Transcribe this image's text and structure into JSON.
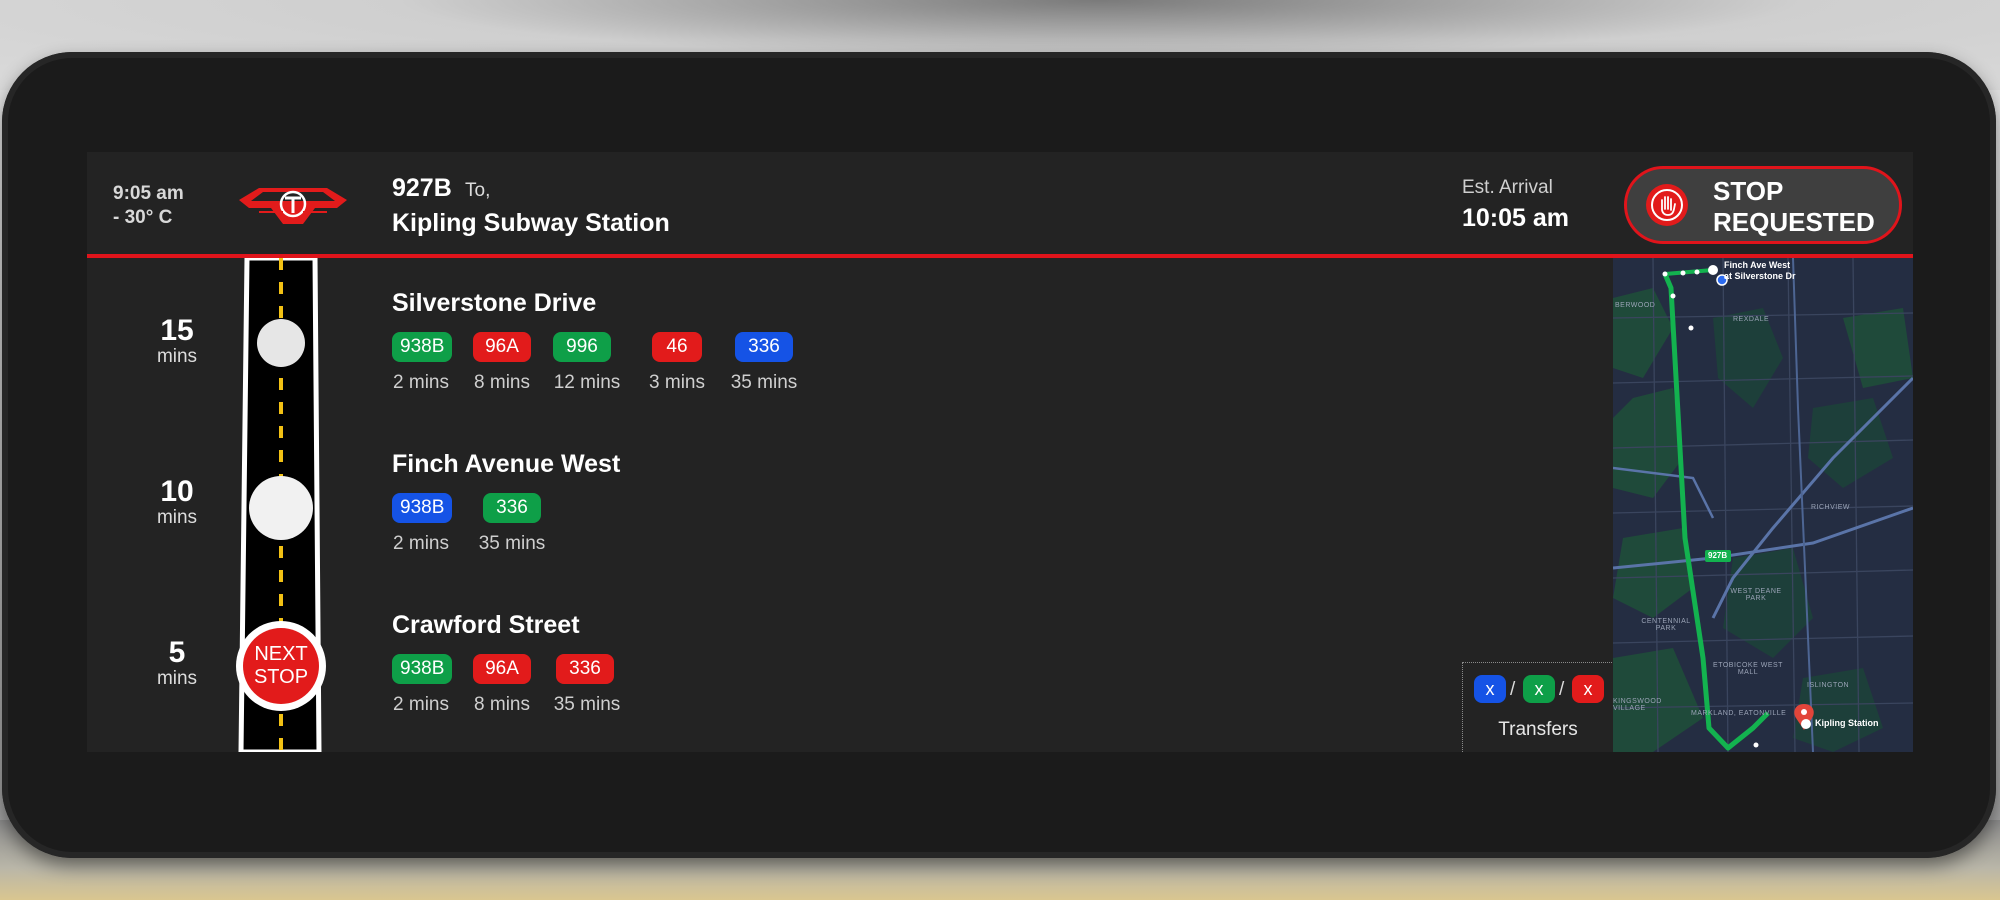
{
  "header": {
    "time": "9:05 am",
    "temperature": "- 30° C",
    "route_number": "927B",
    "route_to": "To,",
    "destination": "Kipling Subway Station",
    "eta_label": "Est. Arrival",
    "eta_time": "10:05 am",
    "stop_button_line1": "STOP",
    "stop_button_line2": "REQUESTED"
  },
  "colors": {
    "green": "#0e9f48",
    "red": "#e21b1b",
    "blue": "#1553e6",
    "accent": "#e0141b"
  },
  "timeline": {
    "next_stop_line1": "NEXT",
    "next_stop_line2": "STOP"
  },
  "stops": [
    {
      "minutes": "15",
      "unit": "mins",
      "name": "Silverstone Drive",
      "routes": [
        {
          "route": "938B",
          "color": "green",
          "time": "2 mins"
        },
        {
          "route": "96A",
          "color": "red",
          "time": "8 mins"
        },
        {
          "route": "996",
          "color": "green",
          "time": "12 mins"
        },
        {
          "route": "46",
          "color": "red",
          "time": "3 mins"
        },
        {
          "route": "336",
          "color": "blue",
          "time": "35 mins"
        }
      ]
    },
    {
      "minutes": "10",
      "unit": "mins",
      "name": "Finch Avenue West",
      "routes": [
        {
          "route": "938B",
          "color": "blue",
          "time": "2 mins"
        },
        {
          "route": "336",
          "color": "green",
          "time": "35 mins"
        }
      ]
    },
    {
      "minutes": "5",
      "unit": "mins",
      "name": "Crawford Street",
      "routes": [
        {
          "route": "938B",
          "color": "green",
          "time": "2 mins"
        },
        {
          "route": "96A",
          "color": "red",
          "time": "8 mins"
        },
        {
          "route": "336",
          "color": "red",
          "time": "35 mins"
        }
      ]
    }
  ],
  "transfers": {
    "chips": [
      {
        "label": "x",
        "color": "blue"
      },
      {
        "label": "x",
        "color": "green"
      },
      {
        "label": "x",
        "color": "red"
      }
    ],
    "separator": "/",
    "label": "Transfers"
  },
  "map": {
    "start_label_1": "Finch Ave West",
    "start_label_2": "at Silverstone Dr",
    "end_label": "Kipling Station",
    "route_badge": "927B",
    "areas": [
      "BERWOOD",
      "REXDALE",
      "RICHVIEW",
      "WEST DEANE PARK",
      "CENTENNIAL PARK",
      "ETOBICOKE WEST MALL",
      "MARKLAND, EATONVILLE",
      "ISLINGTON",
      "KINGSWOOD VILLAGE"
    ]
  }
}
